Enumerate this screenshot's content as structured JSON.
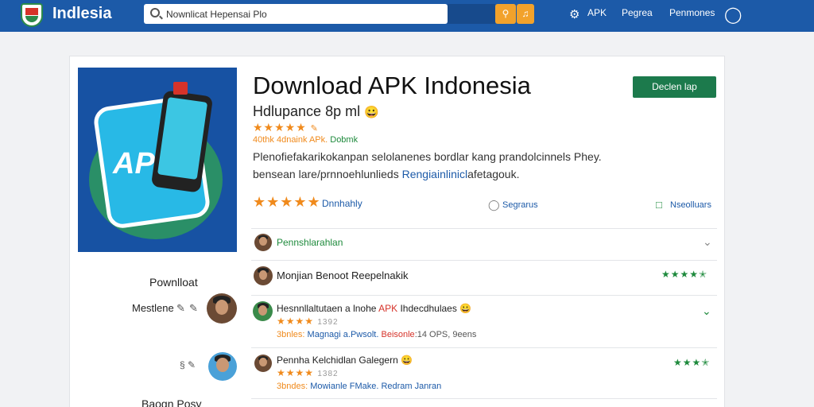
{
  "header": {
    "brand": "Indlesia",
    "search_value": "Nownlicat Hepensai Plo",
    "nav": [
      "APK",
      "Pegrea",
      "Penmones"
    ]
  },
  "app": {
    "title": "Download APK Indonesia",
    "subtitle": "Hdlupance 8p ml",
    "meta_prefix": "40thk 4dnaink APk.",
    "meta_link": "Dobmk",
    "desc1": "Plenofiefakarikokanpan selolanenes bordlar kang prandolcinnels Phey.",
    "desc2_prefix": "bensean lare/prnnoehlunlieds ",
    "desc2_link": "Rengiainlinicl",
    "desc2_suffix": "afetagouk.",
    "download_button": "Declen lap",
    "rating_label": "Dnnhahly",
    "action1": "Segrarus",
    "action2": "Nseolluars",
    "rating": 5
  },
  "sidebar": {
    "download_label": "Pownlloat",
    "user1": "Mestlene",
    "footer_label": "Baogn Posy"
  },
  "reviews": [
    {
      "name": "Pennshlarahlan",
      "color": "green"
    },
    {
      "name": "Monjian Benoot Reepelnakik",
      "stars": 4.5
    },
    {
      "name_a": "Hesnnllaltutaen a lnohe ",
      "name_b": "APK",
      "name_c": " Ihdecdhulaes",
      "rating": 4,
      "meta": "1392",
      "line_a": "3bnles:",
      "line_b": " Magnagi a.Pwsolt. ",
      "line_c": "Beisonle",
      "line_d": ":14 OPS, 9eens"
    },
    {
      "name": "Pennha Kelchidlan Galegern",
      "rating": 4,
      "meta": "1382",
      "line_a": "3bndes:",
      "line_b": " Mowianle FMake. Redram Janran",
      "stars": 4
    }
  ]
}
